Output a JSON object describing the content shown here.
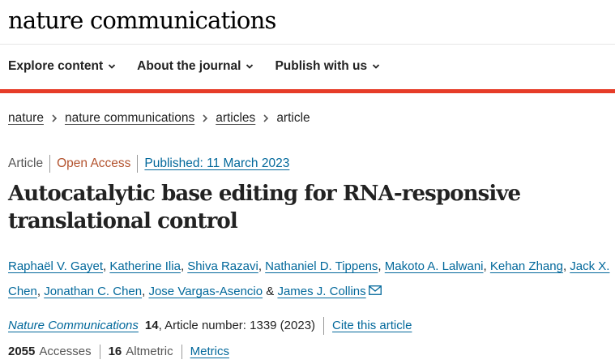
{
  "header": {
    "brand": "nature communications"
  },
  "nav": {
    "items": [
      {
        "label": "Explore content"
      },
      {
        "label": "About the journal"
      },
      {
        "label": "Publish with us"
      }
    ]
  },
  "breadcrumb": {
    "items": [
      "nature",
      "nature communications",
      "articles"
    ],
    "current": "article"
  },
  "article": {
    "type": "Article",
    "access": "Open Access",
    "published": "Published: 11 March 2023",
    "title": "Autocatalytic base editing for RNA-responsive translational control",
    "authors": [
      "Raphaël V. Gayet",
      "Katherine Ilia",
      "Shiva Razavi",
      "Nathaniel D. Tippens",
      "Makoto A. Lalwani",
      "Kehan Zhang",
      "Jack X. Chen",
      "Jonathan C. Chen",
      "Jose Vargas-Asencio",
      "James J. Collins"
    ],
    "author_separator": ", ",
    "author_last_separator": " & "
  },
  "citation": {
    "journal": "Nature Communications",
    "volume": "14",
    "article_number": ", Article number: 1339 (2023)",
    "cite_label": "Cite this article"
  },
  "metrics": {
    "accesses": "2055",
    "accesses_label": "Accesses",
    "altmetric": "16",
    "altmetric_label": "Altmetric",
    "metrics_link": "Metrics"
  },
  "colors": {
    "link": "#02689b",
    "accent_bar": "#e63c28",
    "open_access": "#b3532e"
  }
}
